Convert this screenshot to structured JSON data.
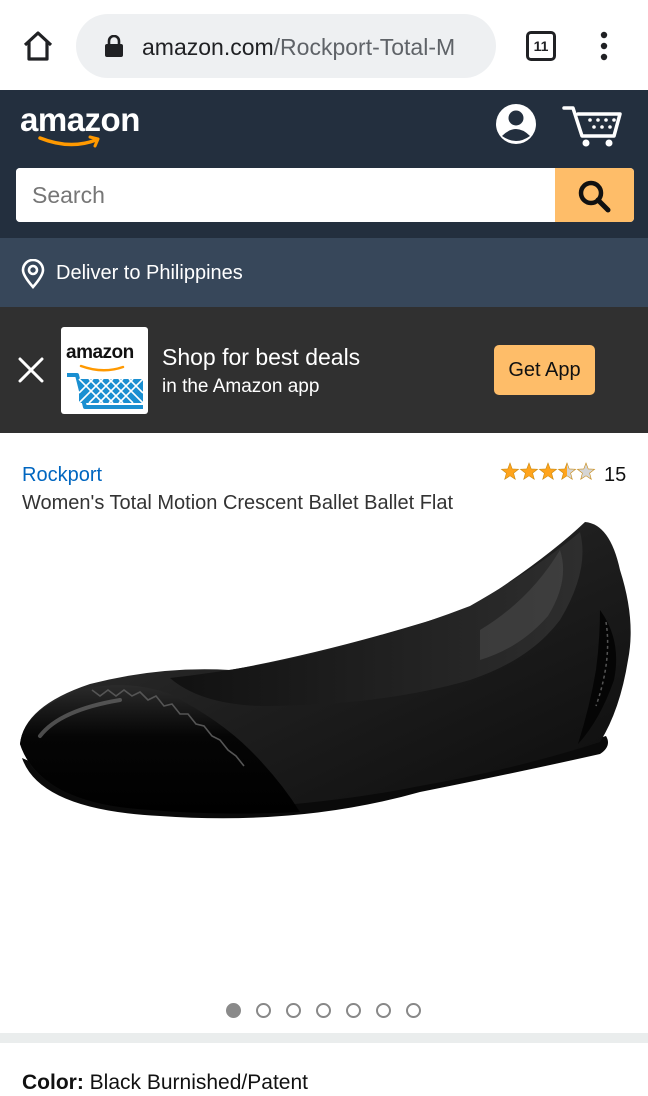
{
  "browser": {
    "url_domain": "amazon.com",
    "url_path": "/Rockport-Total-M",
    "tab_count": "11"
  },
  "header": {
    "logo_text": "amazon",
    "search_placeholder": "Search"
  },
  "deliver": {
    "label": "Deliver to Philippines"
  },
  "app_banner": {
    "logo_text": "amazon",
    "title": "Shop for best deals",
    "subtitle": "in the Amazon app",
    "button_label": "Get App"
  },
  "product": {
    "brand": "Rockport",
    "title": "Women's Total Motion Crescent Ballet Ballet Flat",
    "rating": 3.5,
    "rating_max": 5,
    "review_count": "15",
    "image_count": 7,
    "active_image_index": 0,
    "color_label": "Color:",
    "color_value": "Black Burnished/Patent"
  },
  "colors": {
    "header_bg": "#232f3e",
    "deliver_bg": "#37475a",
    "banner_bg": "#303030",
    "accent": "#febd69",
    "link": "#0066c0",
    "star": "#ffa41c"
  }
}
